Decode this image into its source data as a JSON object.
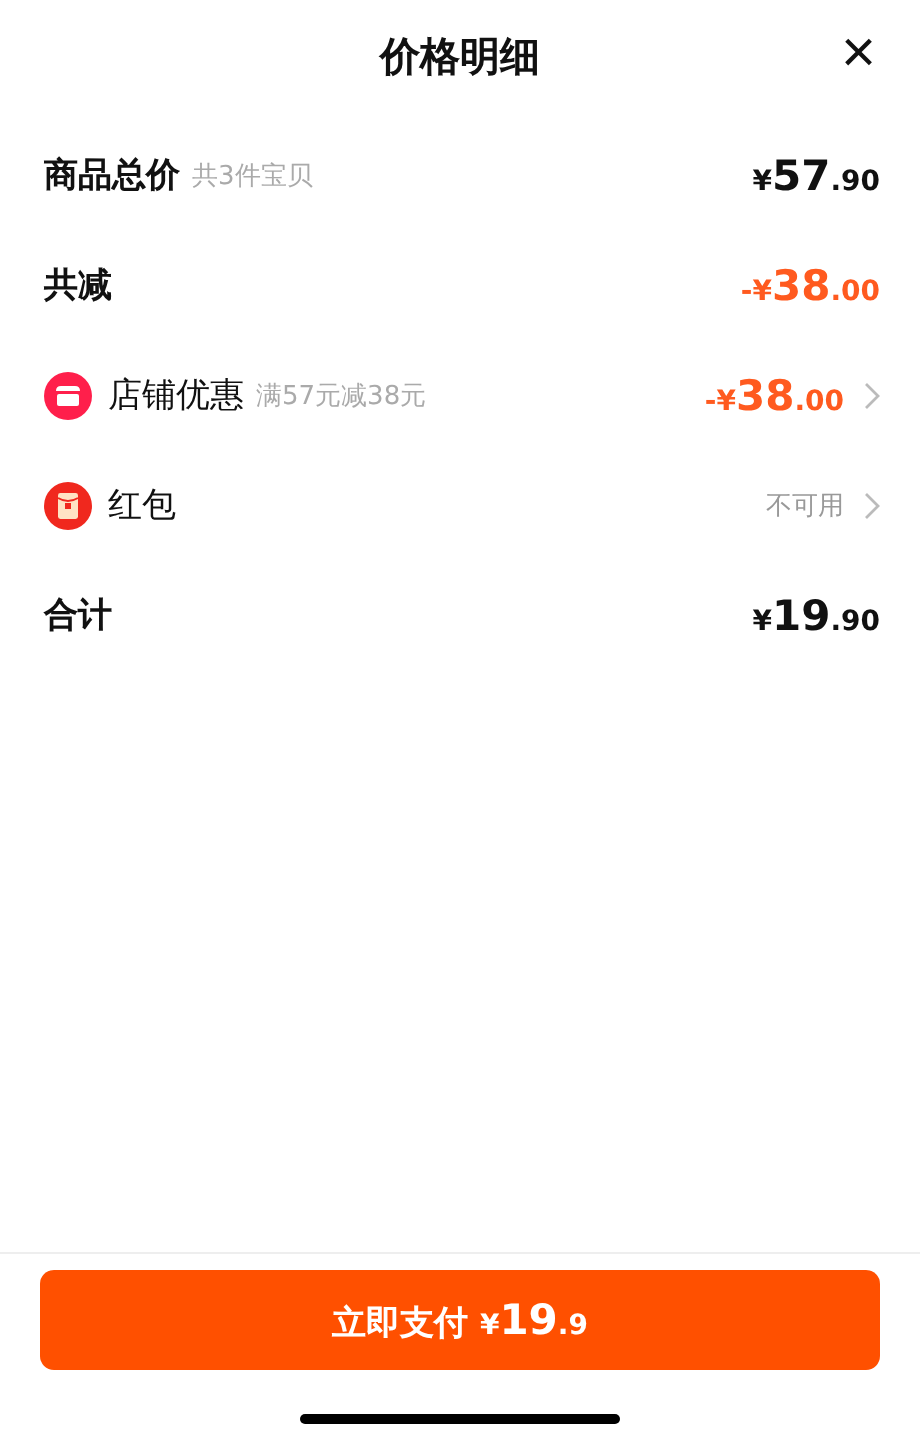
{
  "header": {
    "title": "价格明细",
    "close": "×"
  },
  "rows": [
    {
      "kind": "summary",
      "label": "商品总价",
      "note": "共3件宝贝",
      "price": {
        "prefix": "¥",
        "main": "57",
        "fraction": ".90"
      },
      "discount": false,
      "link": false
    },
    {
      "kind": "summary",
      "label": "共减",
      "price": {
        "prefix": "-¥",
        "main": "38",
        "fraction": ".00"
      },
      "discount": true,
      "link": false
    },
    {
      "kind": "shop",
      "label": "店铺优惠",
      "note": "满57元减38元",
      "price": {
        "prefix": "-¥",
        "main": "38",
        "fraction": ".00"
      },
      "discount": true,
      "link": true
    },
    {
      "kind": "red-packet",
      "label": "红包",
      "status": "不可用",
      "link": true
    },
    {
      "kind": "summary",
      "label": "合计",
      "price": {
        "prefix": "¥",
        "main": "19",
        "fraction": ".90"
      },
      "discount": false,
      "link": false
    }
  ],
  "pay_button": {
    "label": "立即支付",
    "price": {
      "prefix": "¥",
      "main": "19",
      "fraction": ".9"
    }
  }
}
